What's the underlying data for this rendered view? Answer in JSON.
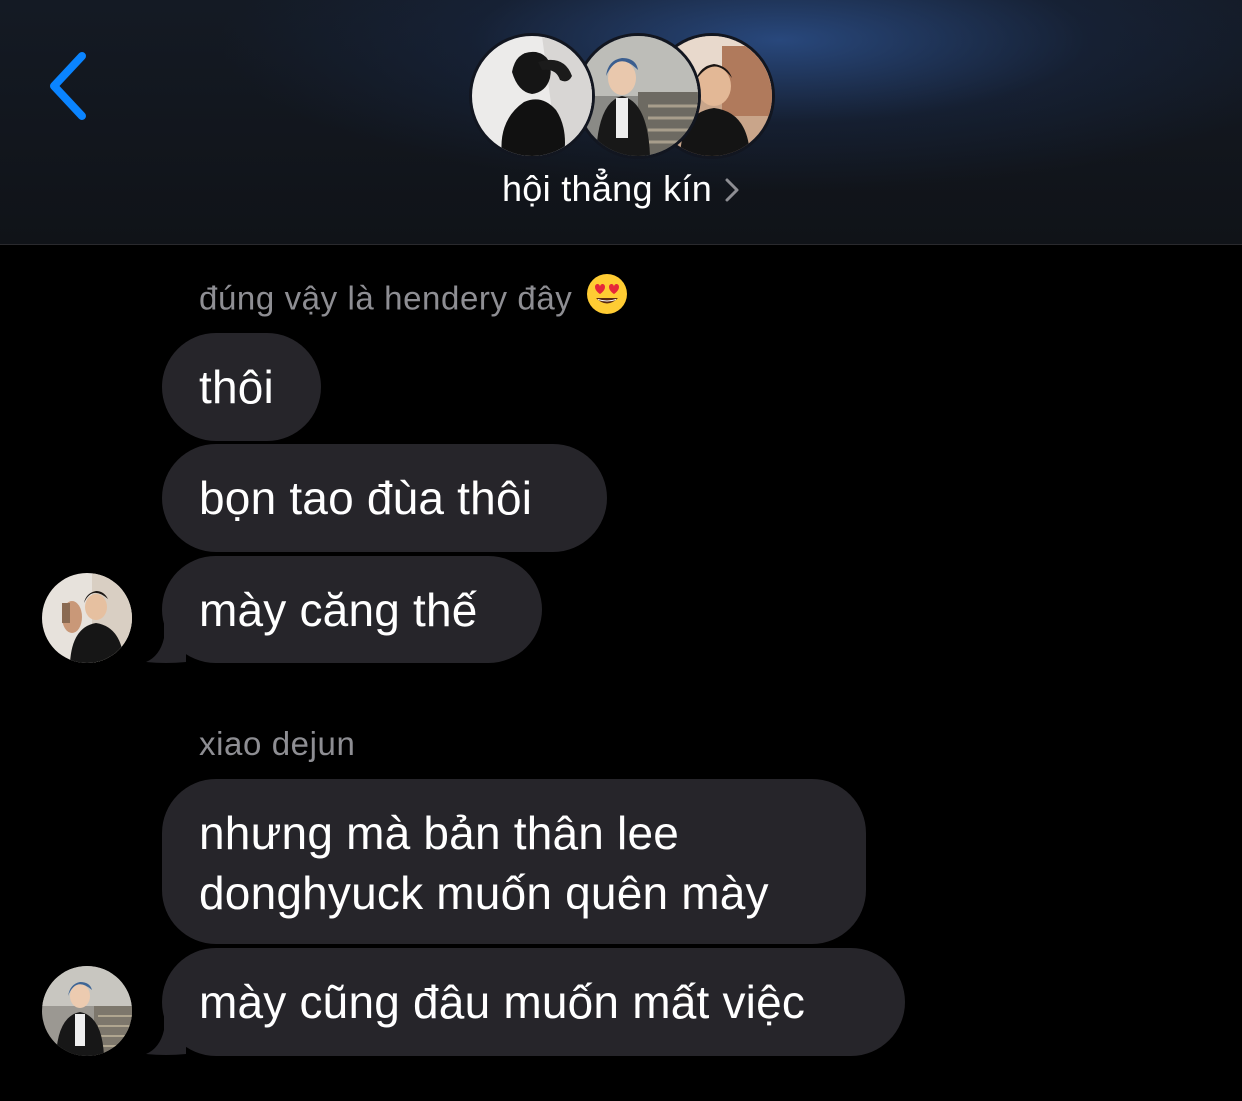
{
  "header": {
    "back_icon": "chevron-left-icon",
    "group_title": "hội thẳng kín",
    "title_chevron_icon": "chevron-right-icon",
    "accent_color": "#0a84ff"
  },
  "group_avatars": [
    "avatar-photo-1",
    "avatar-photo-2",
    "avatar-photo-3"
  ],
  "messages": [
    {
      "sender": "đúng vậy là hendery đây",
      "sender_emoji": "heart-eyes-emoji",
      "bubbles": [
        "thôi",
        "bọn tao đùa thôi",
        "mày căng thế"
      ]
    },
    {
      "sender": "xiao dejun",
      "bubbles": [
        "nhưng mà bản thân lee donghyuck muốn quên mày",
        "mày cũng đâu muốn mất việc"
      ]
    }
  ],
  "colors": {
    "bubble_bg": "#26252a",
    "sender_text": "#8e8e93",
    "background": "#000000"
  }
}
